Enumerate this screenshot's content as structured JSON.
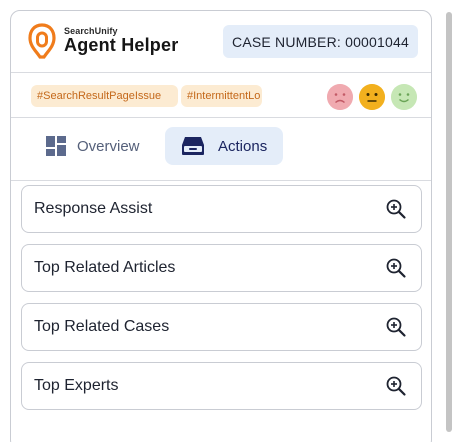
{
  "header": {
    "brand_small": "SearchUnify",
    "brand_big": "Agent Helper",
    "case_number": "CASE NUMBER: 00001044"
  },
  "tags": [
    "#SearchResultPageIssue",
    "#IntermittentLo"
  ],
  "sentiment": [
    {
      "name": "sad-face-icon",
      "color": "#f0aab0"
    },
    {
      "name": "neutral-face-icon",
      "color": "#f2b01e"
    },
    {
      "name": "happy-face-icon",
      "color": "#c6e7b5"
    }
  ],
  "tabs": [
    {
      "label": "Overview",
      "icon": "grid-icon",
      "active": false
    },
    {
      "label": "Actions",
      "icon": "inbox-icon",
      "active": true
    }
  ],
  "cards": [
    {
      "label": "Response Assist",
      "icon": "zoom-in-icon"
    },
    {
      "label": "Top Related Articles",
      "icon": "zoom-in-icon"
    },
    {
      "label": "Top Related Cases",
      "icon": "zoom-in-icon"
    },
    {
      "label": "Top Experts",
      "icon": "zoom-in-icon"
    }
  ],
  "colors": {
    "brand_orange": "#f07c1b",
    "accent_bg": "#e4edf9",
    "tag_bg": "#fcebd2",
    "tag_text": "#c4681a",
    "active_tab_text": "#1b2560"
  }
}
